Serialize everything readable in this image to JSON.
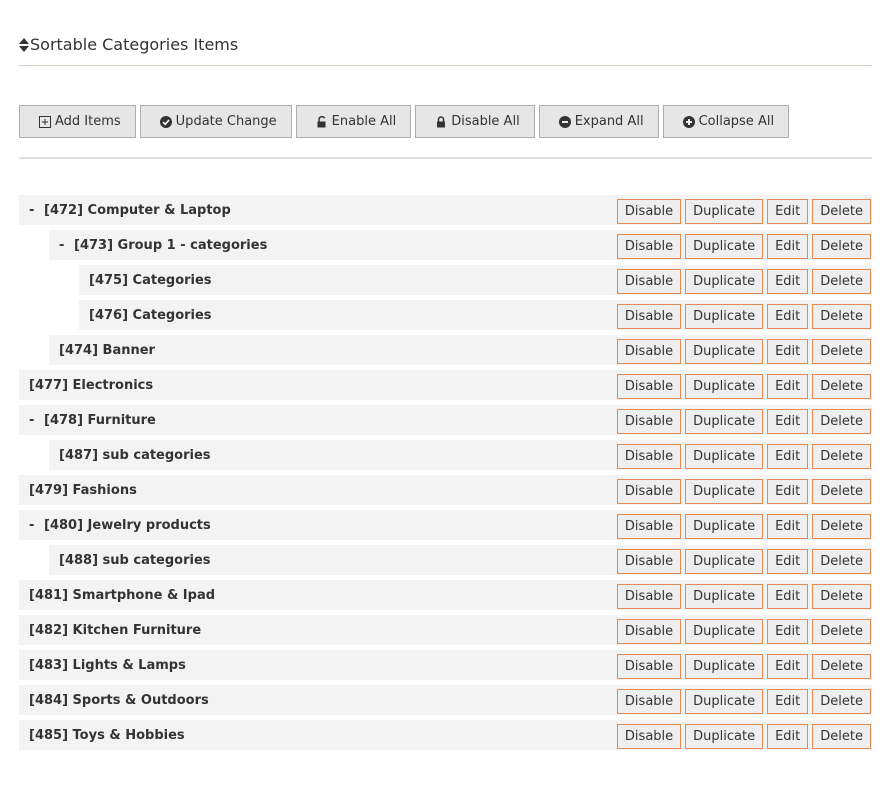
{
  "header": {
    "title": "Sortable Categories Items"
  },
  "toolbar": {
    "add_items": "Add Items",
    "update_change": "Update Change",
    "enable_all": "Enable All",
    "disable_all": "Disable All",
    "expand_all": "Expand All",
    "collapse_all": "Collapse All"
  },
  "actions": {
    "disable": "Disable",
    "duplicate": "Duplicate",
    "edit": "Edit",
    "delete": "Delete"
  },
  "toggle_symbol": "-",
  "items": [
    {
      "label": "[472] Computer & Laptop",
      "depth": 0,
      "expanded": true
    },
    {
      "label": "[473] Group 1 - categories",
      "depth": 1,
      "expanded": true
    },
    {
      "label": "[475] Categories",
      "depth": 2,
      "expanded": null
    },
    {
      "label": "[476] Categories",
      "depth": 2,
      "expanded": null
    },
    {
      "label": "[474] Banner",
      "depth": 1,
      "expanded": null
    },
    {
      "label": "[477] Electronics",
      "depth": 0,
      "expanded": null
    },
    {
      "label": "[478] Furniture",
      "depth": 0,
      "expanded": true
    },
    {
      "label": "[487] sub categories",
      "depth": 1,
      "expanded": null
    },
    {
      "label": "[479] Fashions",
      "depth": 0,
      "expanded": null
    },
    {
      "label": "[480] Jewelry products",
      "depth": 0,
      "expanded": true
    },
    {
      "label": "[488] sub categories",
      "depth": 1,
      "expanded": null
    },
    {
      "label": "[481] Smartphone & Ipad",
      "depth": 0,
      "expanded": null
    },
    {
      "label": "[482] Kitchen Furniture",
      "depth": 0,
      "expanded": null
    },
    {
      "label": "[483] Lights & Lamps",
      "depth": 0,
      "expanded": null
    },
    {
      "label": "[484] Sports & Outdoors",
      "depth": 0,
      "expanded": null
    },
    {
      "label": "[485] Toys & Hobbies",
      "depth": 0,
      "expanded": null
    }
  ]
}
